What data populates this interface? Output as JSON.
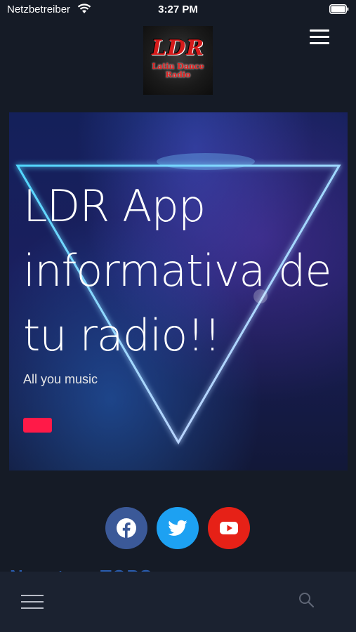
{
  "status_bar": {
    "carrier": "Netzbetreiber",
    "time": "3:27 PM",
    "wifi_icon": "wifi-icon",
    "battery_icon": "battery-icon"
  },
  "header": {
    "logo": {
      "letters": "LDR",
      "subtitle_line1": "Latin Dance",
      "subtitle_line2": "Radio"
    },
    "menu_icon": "hamburger-menu-icon"
  },
  "hero": {
    "title": "LDR App informativa de tu radio!!",
    "subtitle": "All you music",
    "button_color": "#ff1a48"
  },
  "social": [
    {
      "name": "facebook",
      "icon": "facebook-icon",
      "color": "#3b5998"
    },
    {
      "name": "twitter",
      "icon": "twitter-icon",
      "color": "#1da1f2"
    },
    {
      "name": "youtube",
      "icon": "youtube-icon",
      "color": "#e62117"
    }
  ],
  "section_peek": "Nuestros TOPS",
  "bottom_bar": {
    "menu_icon": "hamburger-menu-icon",
    "search_icon": "search-icon"
  },
  "colors": {
    "background": "#151b26",
    "bottom_bar": "#1b2230",
    "accent": "#ff1a48"
  }
}
